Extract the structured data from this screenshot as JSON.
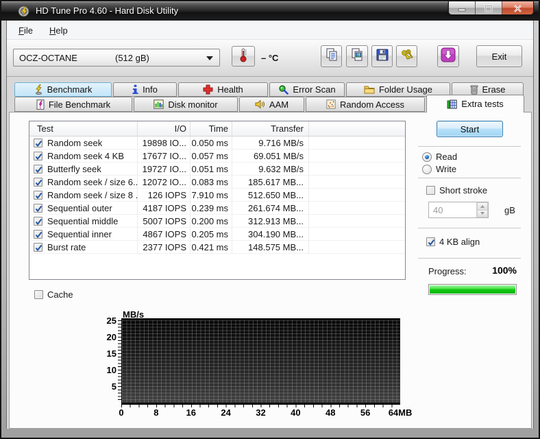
{
  "window": {
    "title": "HD Tune Pro 4.60 - Hard Disk Utility"
  },
  "window_controls": {
    "minimize": "minimize-button",
    "maximize": "maximize-button",
    "close": "close-button"
  },
  "menu": {
    "items": [
      {
        "label": "File"
      },
      {
        "label": "Help"
      }
    ]
  },
  "toolbar": {
    "drive_selector": {
      "name": "OCZ-OCTANE",
      "capacity": "(512 gB)"
    },
    "temperature": {
      "value": "–",
      "unit": "°C",
      "icon": "thermometer-icon"
    },
    "buttons": [
      {
        "icon": "copy-text-icon"
      },
      {
        "icon": "copy-image-icon"
      },
      {
        "icon": "save-icon"
      },
      {
        "icon": "keys-icon"
      },
      {
        "icon": "download-arrow-icon"
      }
    ],
    "exit_label": "Exit"
  },
  "tabs": {
    "row1": [
      {
        "label": "Benchmark",
        "icon": "benchmark-icon",
        "highlighted": true
      },
      {
        "label": "Info",
        "icon": "info-icon"
      },
      {
        "label": "Health",
        "icon": "health-icon"
      },
      {
        "label": "Error Scan",
        "icon": "error-scan-icon"
      },
      {
        "label": "Folder Usage",
        "icon": "folder-icon"
      },
      {
        "label": "Erase",
        "icon": "erase-icon"
      }
    ],
    "row2": [
      {
        "label": "File Benchmark",
        "icon": "file-benchmark-icon"
      },
      {
        "label": "Disk monitor",
        "icon": "disk-monitor-icon"
      },
      {
        "label": "AAM",
        "icon": "speaker-icon"
      },
      {
        "label": "Random Access",
        "icon": "random-access-icon"
      },
      {
        "label": "Extra tests",
        "icon": "extra-tests-icon",
        "active": true
      }
    ]
  },
  "table": {
    "columns": [
      "Test",
      "I/O",
      "Time",
      "Transfer"
    ],
    "rows": [
      {
        "checked": true,
        "test": "Random seek",
        "io": "19898 IO...",
        "time": "0.050 ms",
        "transfer": "9.716 MB/s"
      },
      {
        "checked": true,
        "test": "Random seek 4 KB",
        "io": "17677 IO...",
        "time": "0.057 ms",
        "transfer": "69.051 MB/s"
      },
      {
        "checked": true,
        "test": "Butterfly seek",
        "io": "19727 IO...",
        "time": "0.051 ms",
        "transfer": "9.632 MB/s"
      },
      {
        "checked": true,
        "test": "Random seek / size 6...",
        "io": "12072 IO...",
        "time": "0.083 ms",
        "transfer": "185.617 MB..."
      },
      {
        "checked": true,
        "test": "Random seek / size 8 ...",
        "io": "126 IOPS",
        "time": "7.910 ms",
        "transfer": "512.650 MB..."
      },
      {
        "checked": true,
        "test": "Sequential outer",
        "io": "4187 IOPS",
        "time": "0.239 ms",
        "transfer": "261.674 MB..."
      },
      {
        "checked": true,
        "test": "Sequential middle",
        "io": "5007 IOPS",
        "time": "0.200 ms",
        "transfer": "312.913 MB..."
      },
      {
        "checked": true,
        "test": "Sequential inner",
        "io": "4867 IOPS",
        "time": "0.205 ms",
        "transfer": "304.190 MB..."
      },
      {
        "checked": true,
        "test": "Burst rate",
        "io": "2377 IOPS",
        "time": "0.421 ms",
        "transfer": "148.575 MB..."
      }
    ]
  },
  "controls": {
    "start_label": "Start",
    "read": {
      "label": "Read",
      "selected": true
    },
    "write": {
      "label": "Write",
      "selected": false
    },
    "short_stroke": {
      "label": "Short stroke",
      "checked": false
    },
    "short_stroke_size": {
      "value": "40",
      "unit": "gB",
      "enabled": false
    },
    "align": {
      "label": "4 KB align",
      "checked": true
    },
    "progress": {
      "label": "Progress:",
      "value": "100%",
      "percent": 100
    }
  },
  "cache": {
    "label": "Cache",
    "checked": false
  },
  "chart_data": {
    "type": "line",
    "title": "",
    "ylabel": "MB/s",
    "xlabel": "MB",
    "y_ticks": [
      25,
      20,
      15,
      10,
      5
    ],
    "x_ticks": [
      "0",
      "8",
      "16",
      "24",
      "32",
      "40",
      "48",
      "56",
      "64MB"
    ],
    "x_values": [
      0,
      8,
      16,
      24,
      32,
      40,
      48,
      56,
      64
    ],
    "ylim": [
      0,
      25
    ],
    "xlim": [
      0,
      64
    ],
    "grid": "on",
    "series": [],
    "note": "empty plot - no data recorded",
    "plot_background": "black gradient"
  },
  "colors": {
    "tab_highlight": "#c4e5f8",
    "start_button_border": "#3c7fb1",
    "progress_green": "#0ec60e",
    "download_purple": "#bd3fbd",
    "health_red": "#dd2f2f",
    "thermometer_red": "#cc2222",
    "close_button_red": "#c04a2d"
  }
}
